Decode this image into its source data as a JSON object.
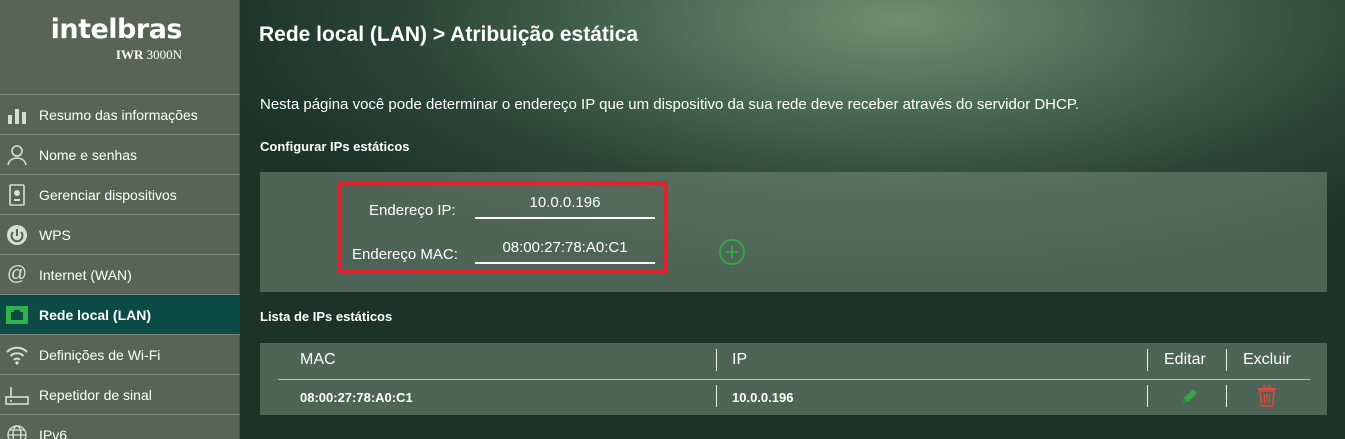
{
  "brand": {
    "logo": "intelbras",
    "model_prefix": "IWR",
    "model_suffix": "3000N"
  },
  "sidebar": {
    "items": [
      {
        "label": "Resumo das informações",
        "icon": "bar-chart-icon",
        "active": false
      },
      {
        "label": "Nome e senhas",
        "icon": "user-icon",
        "active": false
      },
      {
        "label": "Gerenciar dispositivos",
        "icon": "device-icon",
        "active": false
      },
      {
        "label": "WPS",
        "icon": "wps-icon",
        "active": false
      },
      {
        "label": "Internet (WAN)",
        "icon": "at-icon",
        "active": false
      },
      {
        "label": "Rede local (LAN)",
        "icon": "lan-icon",
        "active": true
      },
      {
        "label": "Definições de Wi-Fi",
        "icon": "wifi-icon",
        "active": false
      },
      {
        "label": "Repetidor de sinal",
        "icon": "repeater-icon",
        "active": false
      },
      {
        "label": "IPv6",
        "icon": "globe-icon",
        "active": false
      }
    ]
  },
  "main": {
    "title": "Rede local (LAN) > Atribuição estática",
    "description": "Nesta página você pode determinar o endereço IP que um dispositivo da sua rede deve receber através do servidor DHCP.",
    "config_section": "Configurar IPs estáticos",
    "form": {
      "ip_label": "Endereço IP:",
      "ip_value": "10.0.0.196",
      "mac_label": "Endereço MAC:",
      "mac_value": "08:00:27:78:A0:C1"
    },
    "list_section": "Lista de IPs estáticos",
    "table": {
      "headers": {
        "mac": "MAC",
        "ip": "IP",
        "edit": "Editar",
        "delete": "Excluir"
      },
      "rows": [
        {
          "mac": "08:00:27:78:A0:C1",
          "ip": "10.0.0.196"
        }
      ]
    }
  },
  "colors": {
    "accent_active": "#0c4a45",
    "add_green": "#35a646",
    "highlight_red": "#e32230",
    "delete_red": "#e2453c"
  }
}
